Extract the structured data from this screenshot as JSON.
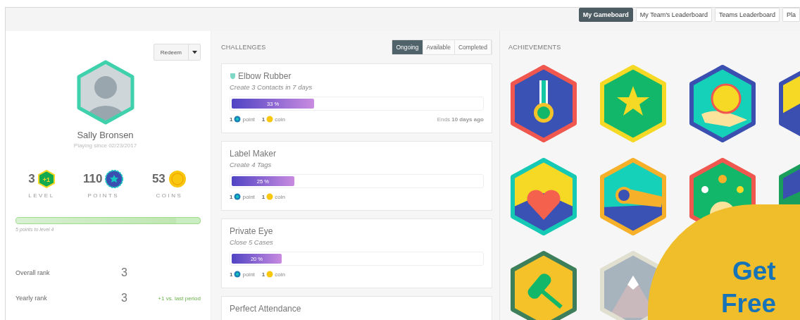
{
  "top_tabs": [
    {
      "label": "My Gameboard",
      "selected": true
    },
    {
      "label": "My Team's Leaderboard",
      "selected": false
    },
    {
      "label": "Teams Leaderboard",
      "selected": false
    },
    {
      "label": "Pla",
      "selected": false
    }
  ],
  "profile": {
    "redeem": "Redeem",
    "name": "Sally Bronsen",
    "since": "Playing since 02/23/2017",
    "stats": [
      {
        "kind": "level",
        "value": "3",
        "badge": "+1",
        "label": "LEVEL"
      },
      {
        "kind": "points",
        "value": "110",
        "label": "POINTS"
      },
      {
        "kind": "coins",
        "value": "53",
        "label": "COINS"
      }
    ],
    "progress": {
      "level": 0.87,
      "caption": "5 points to level 4"
    },
    "ranks": [
      {
        "label": "Overall rank",
        "value": "3"
      },
      {
        "label": "Yearly rank",
        "value": "3",
        "change": "+1 vs. last period"
      }
    ]
  },
  "challenges": {
    "title": "CHALLENGES",
    "tabs": [
      {
        "label": "Ongoing",
        "selected": true
      },
      {
        "label": "Available",
        "selected": false
      },
      {
        "label": "Completed",
        "selected": false
      }
    ],
    "items": [
      {
        "title": "Elbow Rubber",
        "shield": true,
        "subtitle": "Create 3 Contacts in 7 days",
        "level": 0.33,
        "percent": "33 %",
        "points": "1",
        "points_label": "point",
        "coins": "1",
        "coins_label": "coin",
        "ends": "Ends **10 days ago**"
      },
      {
        "title": "Label Maker",
        "shield": false,
        "subtitle": "Create 4 Tags",
        "level": 0.25,
        "percent": "25 %",
        "points": "1",
        "points_label": "point",
        "coins": "1",
        "coins_label": "coin"
      },
      {
        "title": "Private Eye",
        "shield": false,
        "subtitle": "Close 5 Cases",
        "level": 0.2,
        "percent": "20 %",
        "points": "1",
        "points_label": "point",
        "coins": "1",
        "coins_label": "coin"
      },
      {
        "title": "Perfect Attendance",
        "shield": false
      }
    ]
  },
  "achievements": {
    "title": "ACHIEVEMENTS",
    "items": [
      {
        "kind": "medal",
        "color": "#f0584f"
      },
      {
        "kind": "star",
        "color": "#f6d925"
      },
      {
        "kind": "coin",
        "color": "#3a4fb0"
      },
      {
        "kind": "flag",
        "color": "#3a4fb0"
      },
      {
        "kind": "heart",
        "color": "#16c9b5"
      },
      {
        "kind": "telescope",
        "color": "#f6b02a"
      },
      {
        "kind": "people",
        "color": "#f0584f"
      },
      {
        "kind": "mountain",
        "color": "#1a9e5c"
      },
      {
        "kind": "gavel",
        "color": "#3d7f5a"
      },
      {
        "kind": "peak",
        "color": "#e0dfd0"
      }
    ]
  },
  "promo": {
    "lines": [
      "Get",
      "Free"
    ]
  }
}
